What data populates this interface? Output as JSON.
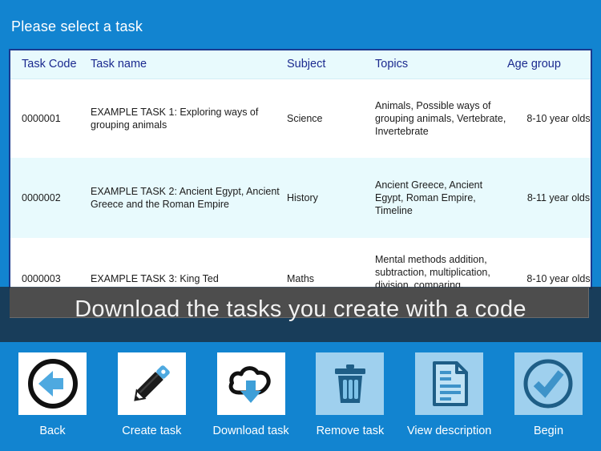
{
  "header": {
    "title": "Please select a task"
  },
  "theme": {
    "background": "#1284d0",
    "table_border": "#1b3a8f",
    "header_row": "#e8fafd",
    "header_text": "#1b2a8f",
    "tile_disabled": "#9fd0ee",
    "overlay": "#4d4d4d"
  },
  "table": {
    "columns": [
      "Task Code",
      "Task name",
      "Subject",
      "Topics",
      "Age group"
    ],
    "rows": [
      {
        "code": "0000001",
        "name": "EXAMPLE TASK 1: Exploring ways of grouping animals",
        "subject": "Science",
        "topics": "Animals, Possible ways of grouping animals, Vertebrate, Invertebrate",
        "age": "8-10 year olds"
      },
      {
        "code": "0000002",
        "name": "EXAMPLE TASK 2: Ancient Egypt, Ancient Greece and the Roman Empire",
        "subject": "History",
        "topics": "Ancient Greece, Ancient Egypt, Roman Empire, Timeline",
        "age": "8-11 year olds"
      },
      {
        "code": "0000003",
        "name": "EXAMPLE TASK 3: King Ted",
        "subject": "Maths",
        "topics": "Mental methods addition, subtraction, multiplication, division, comparing, calculations",
        "age": "8-10 year olds"
      }
    ]
  },
  "tip": {
    "message": "Download the tasks you create with a code"
  },
  "toolbar": {
    "items": [
      {
        "label": "Back",
        "icon": "back-arrow-circle-icon",
        "enabled": true
      },
      {
        "label": "Create task",
        "icon": "pencil-icon",
        "enabled": true
      },
      {
        "label": "Download task",
        "icon": "cloud-download-icon",
        "enabled": true
      },
      {
        "label": "Remove task",
        "icon": "trash-icon",
        "enabled": false
      },
      {
        "label": "View description",
        "icon": "document-icon",
        "enabled": false
      },
      {
        "label": "Begin",
        "icon": "check-circle-icon",
        "enabled": false
      }
    ]
  }
}
